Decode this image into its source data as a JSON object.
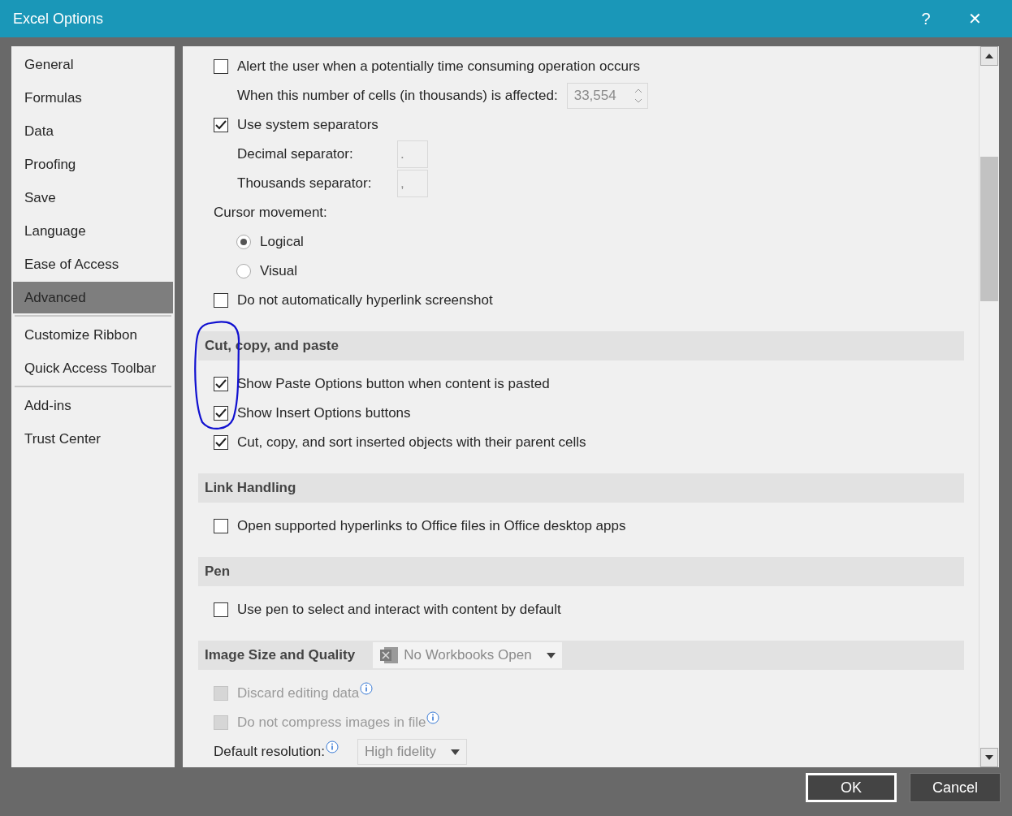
{
  "window": {
    "title": "Excel Options",
    "help": "?",
    "close": "✕"
  },
  "sidebar": {
    "items": [
      {
        "label": "General",
        "selected": false
      },
      {
        "label": "Formulas",
        "selected": false
      },
      {
        "label": "Data",
        "selected": false
      },
      {
        "label": "Proofing",
        "selected": false
      },
      {
        "label": "Save",
        "selected": false
      },
      {
        "label": "Language",
        "selected": false
      },
      {
        "label": "Ease of Access",
        "selected": false
      },
      {
        "label": "Advanced",
        "selected": true,
        "divider": true
      },
      {
        "label": "Customize Ribbon",
        "selected": false
      },
      {
        "label": "Quick Access Toolbar",
        "selected": false,
        "divider": true
      },
      {
        "label": "Add-ins",
        "selected": false
      },
      {
        "label": "Trust Center",
        "selected": false
      }
    ]
  },
  "sections": [
    {
      "items": [
        {
          "kind": "checkbox",
          "label": "Alert the user when a potentially time consuming operation occurs",
          "checked": false,
          "disabled": false,
          "children": [
            {
              "kind": "number",
              "label": "When this number of cells (in thousands) is affected:",
              "value": "33,554"
            }
          ]
        },
        {
          "kind": "checkbox",
          "label": "Use system separators",
          "checked": true,
          "disabled": false,
          "children": [
            {
              "kind": "text",
              "label": "Decimal separator:",
              "value": "."
            },
            {
              "kind": "text",
              "label": "Thousands separator:",
              "value": ","
            }
          ]
        },
        {
          "kind": "label",
          "label": "Cursor movement:",
          "children": [
            {
              "kind": "radio",
              "label": "Logical",
              "selected": true
            },
            {
              "kind": "radio",
              "label": "Visual",
              "selected": false
            }
          ]
        },
        {
          "kind": "checkbox",
          "label": "Do not automatically hyperlink screenshot",
          "checked": false,
          "disabled": false
        }
      ]
    },
    {
      "heading": "Cut, copy, and paste",
      "annotated": true,
      "items": [
        {
          "kind": "checkbox",
          "label": "Show Paste Options button when content is pasted",
          "checked": true,
          "disabled": false
        },
        {
          "kind": "checkbox",
          "label": "Show Insert Options buttons",
          "checked": true,
          "disabled": false
        },
        {
          "kind": "checkbox",
          "label": "Cut, copy, and sort inserted objects with their parent cells",
          "checked": true,
          "disabled": false
        }
      ]
    },
    {
      "heading": "Link Handling",
      "annotated": false,
      "items": [
        {
          "kind": "checkbox",
          "label": "Open supported hyperlinks to Office files in Office desktop apps",
          "checked": false,
          "disabled": false
        }
      ]
    },
    {
      "heading": "Pen",
      "annotated": false,
      "items": [
        {
          "kind": "checkbox",
          "label": "Use pen to select and interact with content by default",
          "checked": false,
          "disabled": false
        }
      ]
    },
    {
      "heading": "Image Size and Quality",
      "annotated": false,
      "workbook_select": {
        "value": "No Workbooks Open"
      },
      "items": [
        {
          "kind": "checkbox",
          "label": "Discard editing data",
          "checked": false,
          "disabled": true,
          "info": true
        },
        {
          "kind": "checkbox",
          "label": "Do not compress images in file",
          "checked": false,
          "disabled": true,
          "info": true
        },
        {
          "kind": "select",
          "label": "Default resolution:",
          "info": true,
          "value": "High fidelity"
        }
      ]
    }
  ],
  "buttons": [
    {
      "label": "OK",
      "default": true
    },
    {
      "label": "Cancel",
      "default": false
    }
  ]
}
